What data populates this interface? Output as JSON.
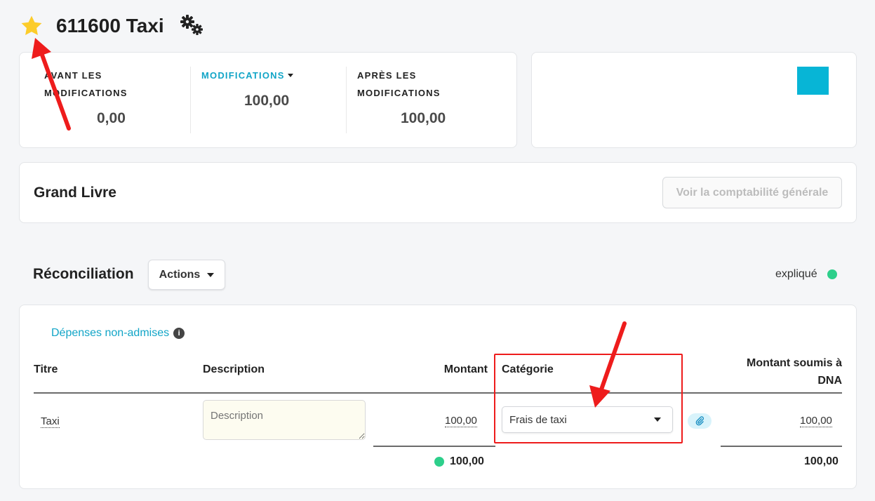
{
  "header": {
    "title": "611600 Taxi",
    "star_icon": "star-icon",
    "settings_icon": "gear-icon"
  },
  "stats": {
    "before": {
      "label_line1": "AVANT LES",
      "label_line2": "MODIFICATIONS",
      "value": "0,00"
    },
    "modifications": {
      "label": "MODIFICATIONS",
      "value": "100,00"
    },
    "after": {
      "label_line1": "APRÈS LES",
      "label_line2": "MODIFICATIONS",
      "value": "100,00"
    }
  },
  "color_card": {
    "swatch_color": "#07b5d6"
  },
  "ledger": {
    "title": "Grand Livre",
    "button_label": "Voir la comptabilité générale"
  },
  "reconciliation": {
    "title": "Réconciliation",
    "actions_label": "Actions",
    "status_label": "expliqué",
    "status_color": "#2dcf8b"
  },
  "table": {
    "non_admises_label": "Dépenses non-admises",
    "columns": {
      "titre": "Titre",
      "description": "Description",
      "montant": "Montant",
      "categorie": "Catégorie",
      "montant_dna_line1": "Montant soumis à",
      "montant_dna_line2": "DNA"
    },
    "rows": [
      {
        "titre": "Taxi",
        "description_placeholder": "Description",
        "montant": "100,00",
        "categorie": "Frais de taxi",
        "montant_dna": "100,00"
      }
    ],
    "total_montant": "100,00",
    "total_dna": "100,00"
  },
  "annotations": {
    "highlight_color": "#ee1c1c"
  },
  "colors": {
    "accent": "#12a5c7",
    "star": "#fccc2a",
    "success": "#2dcf8b"
  }
}
